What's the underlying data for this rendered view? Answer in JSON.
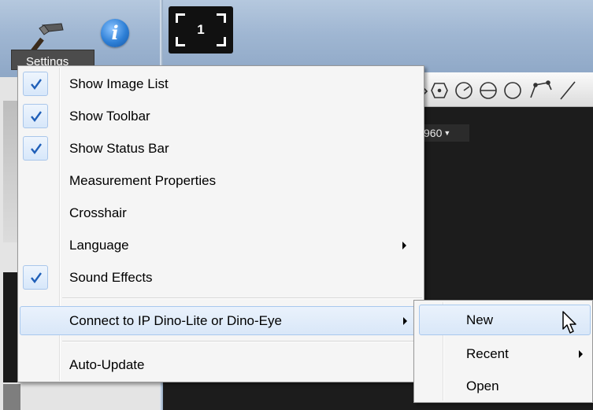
{
  "toolbar": {
    "settings_label": "Settings",
    "info_glyph": "i",
    "view_count": "1",
    "resolution_label": "960"
  },
  "icons": {
    "settings": "hammer-icon",
    "info": "info-icon",
    "check": "checkmark-icon",
    "submenu": "chevron-right-icon",
    "cursor": "mouse-pointer-icon"
  },
  "settings_menu": {
    "items": [
      {
        "label": "Show Image List",
        "checked": true
      },
      {
        "label": "Show Toolbar",
        "checked": true
      },
      {
        "label": "Show Status Bar",
        "checked": true
      },
      {
        "label": "Measurement Properties",
        "checked": false
      },
      {
        "label": "Crosshair",
        "checked": false
      },
      {
        "label": "Language",
        "checked": false,
        "has_submenu": true
      },
      {
        "label": "Sound Effects",
        "checked": true
      },
      {
        "label": "Connect to IP Dino-Lite or Dino-Eye",
        "checked": false,
        "has_submenu": true,
        "highlighted": true
      },
      {
        "label": "Auto-Update",
        "checked": false
      }
    ]
  },
  "connect_submenu": {
    "items": [
      {
        "label": "New",
        "highlighted": true
      },
      {
        "label": "Recent",
        "has_submenu": true
      },
      {
        "label": "Open"
      }
    ]
  },
  "colors": {
    "accent_check": "#1f5fb8",
    "highlight_border": "#a8c8ee",
    "viewer_bg": "#1c1c1c",
    "menu_bg": "#f5f5f5"
  }
}
